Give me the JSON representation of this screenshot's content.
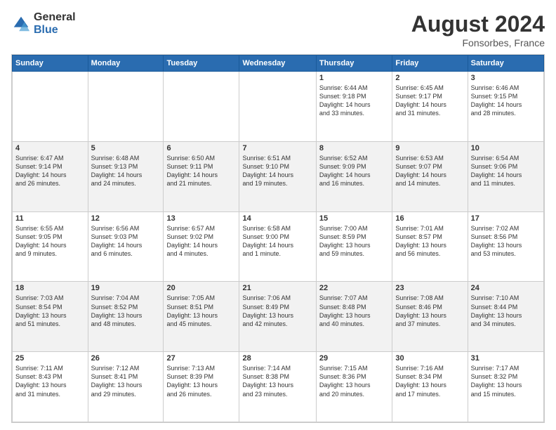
{
  "header": {
    "logo_general": "General",
    "logo_blue": "Blue",
    "title": "August 2024",
    "subtitle": "Fonsorbes, France"
  },
  "days_of_week": [
    "Sunday",
    "Monday",
    "Tuesday",
    "Wednesday",
    "Thursday",
    "Friday",
    "Saturday"
  ],
  "weeks": [
    [
      {
        "day": "",
        "info": ""
      },
      {
        "day": "",
        "info": ""
      },
      {
        "day": "",
        "info": ""
      },
      {
        "day": "",
        "info": ""
      },
      {
        "day": "1",
        "info": "Sunrise: 6:44 AM\nSunset: 9:18 PM\nDaylight: 14 hours\nand 33 minutes."
      },
      {
        "day": "2",
        "info": "Sunrise: 6:45 AM\nSunset: 9:17 PM\nDaylight: 14 hours\nand 31 minutes."
      },
      {
        "day": "3",
        "info": "Sunrise: 6:46 AM\nSunset: 9:15 PM\nDaylight: 14 hours\nand 28 minutes."
      }
    ],
    [
      {
        "day": "4",
        "info": "Sunrise: 6:47 AM\nSunset: 9:14 PM\nDaylight: 14 hours\nand 26 minutes."
      },
      {
        "day": "5",
        "info": "Sunrise: 6:48 AM\nSunset: 9:13 PM\nDaylight: 14 hours\nand 24 minutes."
      },
      {
        "day": "6",
        "info": "Sunrise: 6:50 AM\nSunset: 9:11 PM\nDaylight: 14 hours\nand 21 minutes."
      },
      {
        "day": "7",
        "info": "Sunrise: 6:51 AM\nSunset: 9:10 PM\nDaylight: 14 hours\nand 19 minutes."
      },
      {
        "day": "8",
        "info": "Sunrise: 6:52 AM\nSunset: 9:09 PM\nDaylight: 14 hours\nand 16 minutes."
      },
      {
        "day": "9",
        "info": "Sunrise: 6:53 AM\nSunset: 9:07 PM\nDaylight: 14 hours\nand 14 minutes."
      },
      {
        "day": "10",
        "info": "Sunrise: 6:54 AM\nSunset: 9:06 PM\nDaylight: 14 hours\nand 11 minutes."
      }
    ],
    [
      {
        "day": "11",
        "info": "Sunrise: 6:55 AM\nSunset: 9:05 PM\nDaylight: 14 hours\nand 9 minutes."
      },
      {
        "day": "12",
        "info": "Sunrise: 6:56 AM\nSunset: 9:03 PM\nDaylight: 14 hours\nand 6 minutes."
      },
      {
        "day": "13",
        "info": "Sunrise: 6:57 AM\nSunset: 9:02 PM\nDaylight: 14 hours\nand 4 minutes."
      },
      {
        "day": "14",
        "info": "Sunrise: 6:58 AM\nSunset: 9:00 PM\nDaylight: 14 hours\nand 1 minute."
      },
      {
        "day": "15",
        "info": "Sunrise: 7:00 AM\nSunset: 8:59 PM\nDaylight: 13 hours\nand 59 minutes."
      },
      {
        "day": "16",
        "info": "Sunrise: 7:01 AM\nSunset: 8:57 PM\nDaylight: 13 hours\nand 56 minutes."
      },
      {
        "day": "17",
        "info": "Sunrise: 7:02 AM\nSunset: 8:56 PM\nDaylight: 13 hours\nand 53 minutes."
      }
    ],
    [
      {
        "day": "18",
        "info": "Sunrise: 7:03 AM\nSunset: 8:54 PM\nDaylight: 13 hours\nand 51 minutes."
      },
      {
        "day": "19",
        "info": "Sunrise: 7:04 AM\nSunset: 8:52 PM\nDaylight: 13 hours\nand 48 minutes."
      },
      {
        "day": "20",
        "info": "Sunrise: 7:05 AM\nSunset: 8:51 PM\nDaylight: 13 hours\nand 45 minutes."
      },
      {
        "day": "21",
        "info": "Sunrise: 7:06 AM\nSunset: 8:49 PM\nDaylight: 13 hours\nand 42 minutes."
      },
      {
        "day": "22",
        "info": "Sunrise: 7:07 AM\nSunset: 8:48 PM\nDaylight: 13 hours\nand 40 minutes."
      },
      {
        "day": "23",
        "info": "Sunrise: 7:08 AM\nSunset: 8:46 PM\nDaylight: 13 hours\nand 37 minutes."
      },
      {
        "day": "24",
        "info": "Sunrise: 7:10 AM\nSunset: 8:44 PM\nDaylight: 13 hours\nand 34 minutes."
      }
    ],
    [
      {
        "day": "25",
        "info": "Sunrise: 7:11 AM\nSunset: 8:43 PM\nDaylight: 13 hours\nand 31 minutes."
      },
      {
        "day": "26",
        "info": "Sunrise: 7:12 AM\nSunset: 8:41 PM\nDaylight: 13 hours\nand 29 minutes."
      },
      {
        "day": "27",
        "info": "Sunrise: 7:13 AM\nSunset: 8:39 PM\nDaylight: 13 hours\nand 26 minutes."
      },
      {
        "day": "28",
        "info": "Sunrise: 7:14 AM\nSunset: 8:38 PM\nDaylight: 13 hours\nand 23 minutes."
      },
      {
        "day": "29",
        "info": "Sunrise: 7:15 AM\nSunset: 8:36 PM\nDaylight: 13 hours\nand 20 minutes."
      },
      {
        "day": "30",
        "info": "Sunrise: 7:16 AM\nSunset: 8:34 PM\nDaylight: 13 hours\nand 17 minutes."
      },
      {
        "day": "31",
        "info": "Sunrise: 7:17 AM\nSunset: 8:32 PM\nDaylight: 13 hours\nand 15 minutes."
      }
    ]
  ]
}
